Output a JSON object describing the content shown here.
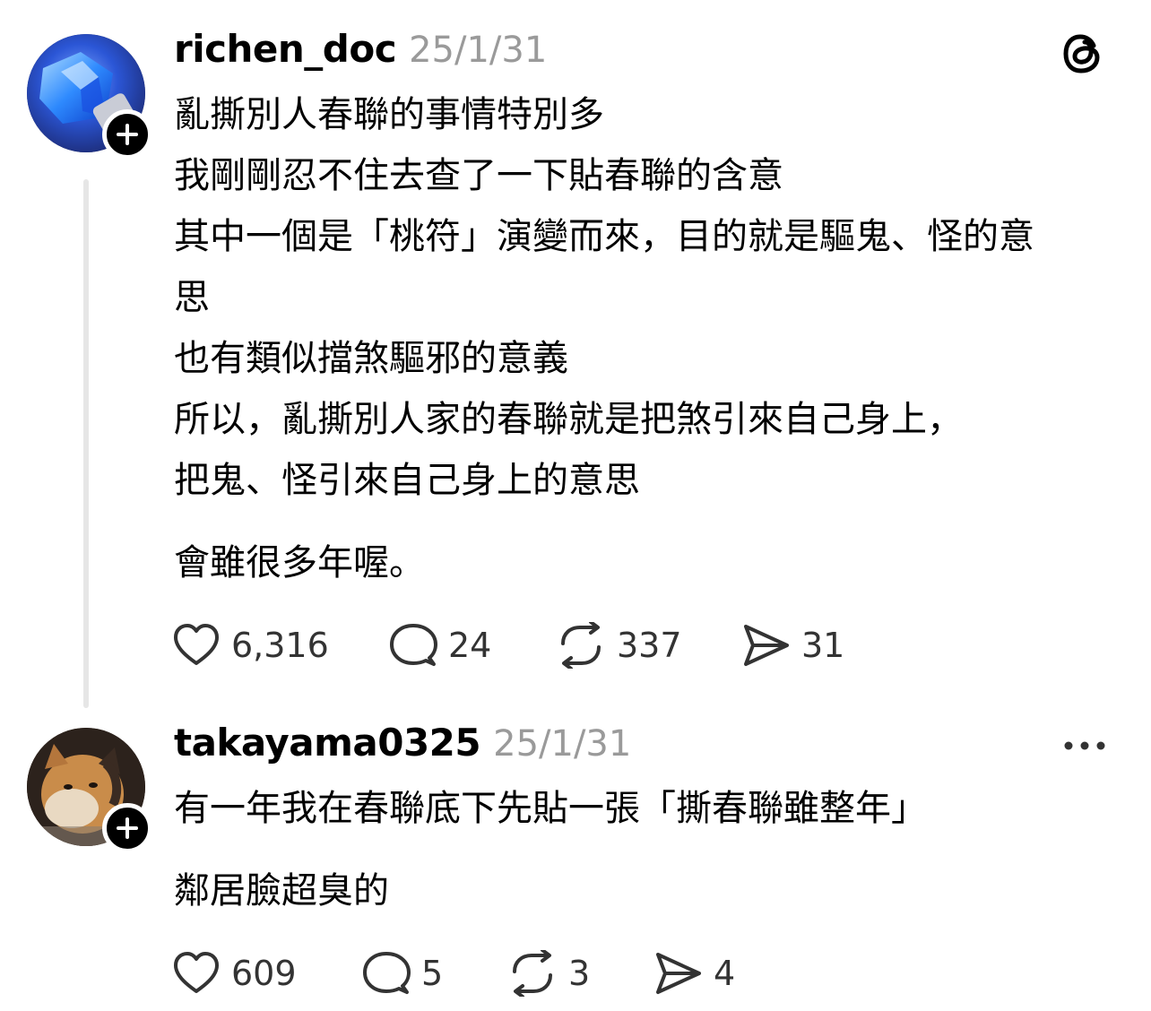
{
  "posts": [
    {
      "username": "richen_doc",
      "timestamp": "25/1/31",
      "avatar": "glowing-blue-crystal-avatar",
      "corner_icon": "threads-logo-icon",
      "paragraphs": [
        {
          "lines": [
            "亂撕別人春聯的事情特別多",
            "我剛剛忍不住去查了一下貼春聯的含意",
            "其中一個是「桃符」演變而來，目的就是驅鬼、怪的意",
            "思",
            "也有類似擋煞驅邪的意義",
            "所以，亂撕別人家的春聯就是把煞引來自己身上，",
            "把鬼、怪引來自己身上的意思"
          ]
        },
        {
          "lines": [
            "會雖很多年喔。"
          ]
        }
      ],
      "stats": {
        "likes": "6,316",
        "replies": "24",
        "reposts": "337",
        "shares": "31"
      }
    },
    {
      "username": "takayama0325",
      "timestamp": "25/1/31",
      "avatar": "cat-photo-avatar",
      "corner_icon": "more-options-icon",
      "paragraphs": [
        {
          "lines": [
            "有一年我在春聯底下先貼一張「撕春聯雖整年」"
          ]
        },
        {
          "lines": [
            "鄰居臉超臭的"
          ]
        }
      ],
      "stats": {
        "likes": "609",
        "replies": "5",
        "reposts": "3",
        "shares": "4"
      }
    }
  ],
  "icons": {
    "like": "heart-icon",
    "reply": "comment-bubble-icon",
    "repost": "repost-arrows-icon",
    "share": "send-paper-plane-icon",
    "follow": "plus-icon"
  },
  "colors": {
    "text": "#000000",
    "muted": "#9a9a9a",
    "thread_line": "#e6e6e6",
    "icon": "#333333"
  }
}
